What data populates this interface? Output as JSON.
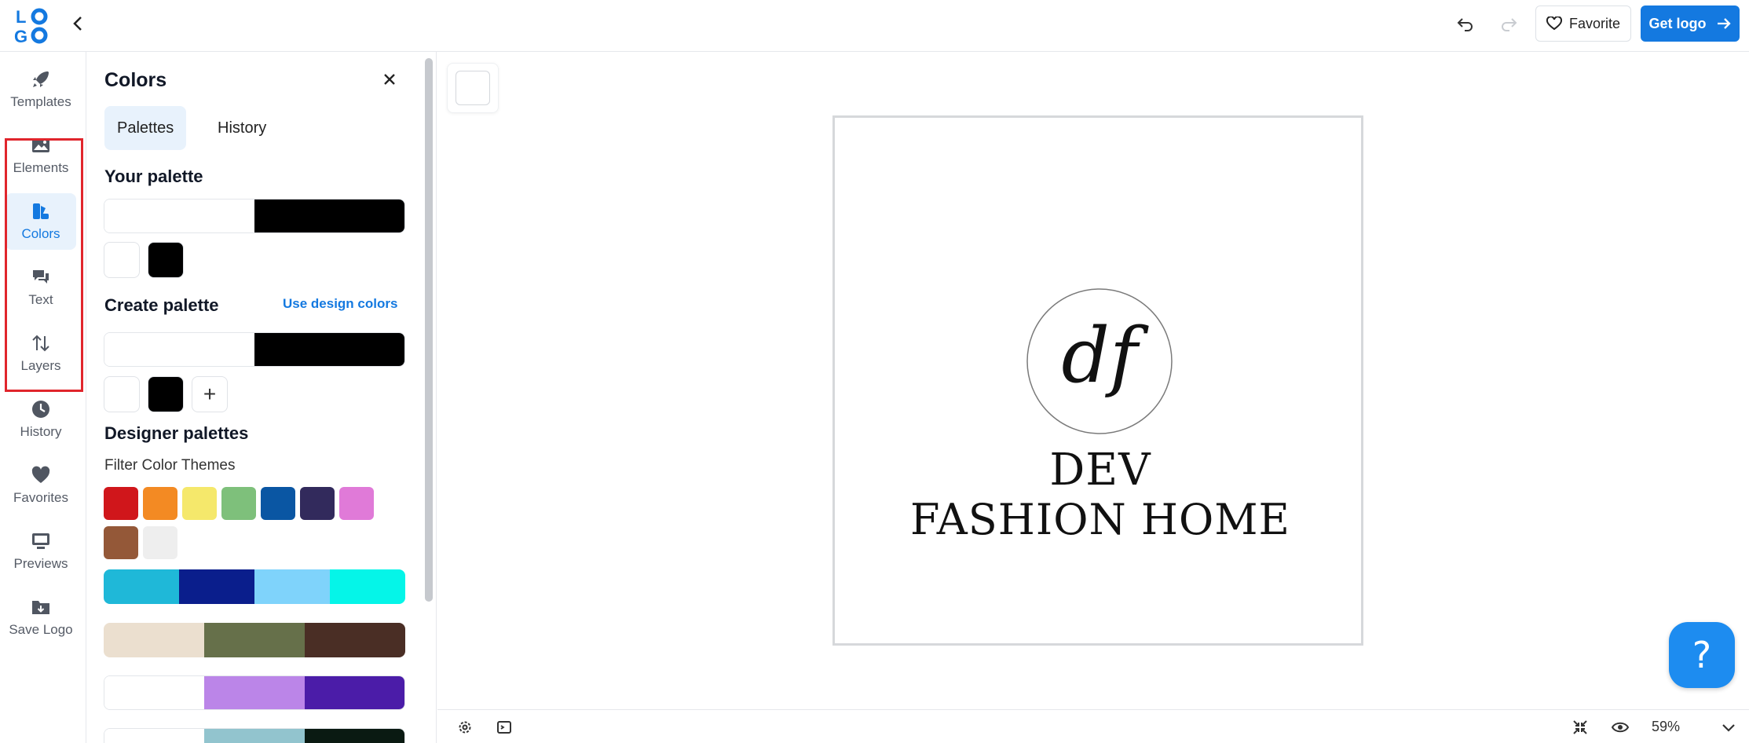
{
  "topbar": {
    "logo_text": "LOGO",
    "favorite_label": "Favorite",
    "get_logo_label": "Get logo"
  },
  "nav": {
    "items": [
      {
        "label": "Templates",
        "icon": "rocket-icon"
      },
      {
        "label": "Elements",
        "icon": "image-icon"
      },
      {
        "label": "Colors",
        "icon": "palette-icon",
        "active": true
      },
      {
        "label": "Text",
        "icon": "speech-bubbles-icon"
      },
      {
        "label": "Layers",
        "icon": "swap-arrows-icon"
      },
      {
        "label": "History",
        "icon": "clock-icon"
      },
      {
        "label": "Favorites",
        "icon": "heart-icon"
      },
      {
        "label": "Previews",
        "icon": "monitor-icon"
      },
      {
        "label": "Save Logo",
        "icon": "folder-download-icon"
      }
    ]
  },
  "panel": {
    "title": "Colors",
    "tabs": [
      {
        "label": "Palettes",
        "active": true
      },
      {
        "label": "History",
        "active": false
      }
    ],
    "your_palette_title": "Your palette",
    "create_palette_title": "Create palette",
    "use_design_colors": "Use design colors",
    "designer_palettes_title": "Designer palettes",
    "filter_label": "Filter Color Themes",
    "your_palette_colors": [
      "#ffffff",
      "#000000"
    ],
    "create_palette_colors": [
      "#ffffff",
      "#000000"
    ],
    "plus_label": "+",
    "theme_colors": [
      "#d0161b",
      "#f38a23",
      "#f5e86b",
      "#7ec07b",
      "#0a56a3",
      "#322a5c",
      "#e07ad8",
      "#945838",
      "#eeeeee"
    ],
    "designer_palettes": [
      [
        "#1fb8d8",
        "#0a1e8c",
        "#7fd3fb",
        "#05f5e8"
      ],
      [
        "#ebdfcf",
        "#66704a",
        "#4a2e25"
      ],
      [
        "#ffffff",
        "#bb85e8",
        "#4b1ca8"
      ],
      [
        "#ffffff",
        "#92c4ce",
        "#0a1a12"
      ]
    ]
  },
  "canvas": {
    "monogram": "df",
    "brand_line1": "DEV",
    "brand_line2": "FASHION HOME",
    "help_label": "?"
  },
  "bottombar": {
    "zoom": "59%"
  }
}
